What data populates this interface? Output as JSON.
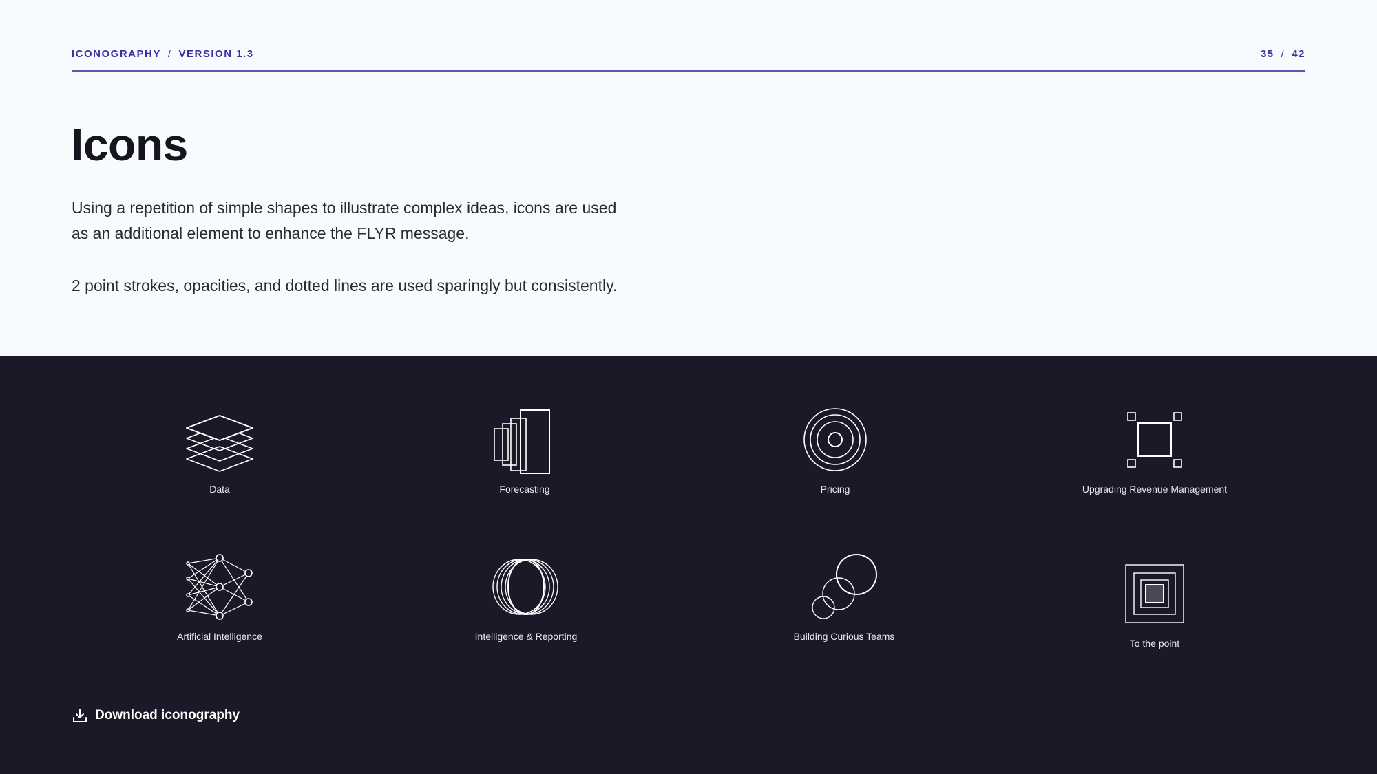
{
  "header": {
    "section": "ICONOGRAPHY",
    "separator": "/",
    "version": "VERSION 1.3",
    "page_current": "35",
    "page_total": "42"
  },
  "title": "Icons",
  "description_1": "Using a repetition of simple shapes to illustrate complex ideas, icons are used as an additional element to enhance the FLYR message.",
  "description_2": "2 point strokes, opacities, and dotted lines are used sparingly but consistently.",
  "icons": [
    {
      "label": "Data",
      "icon": "layers-icon"
    },
    {
      "label": "Forecasting",
      "icon": "stacked-rectangles-icon"
    },
    {
      "label": "Pricing",
      "icon": "target-icon"
    },
    {
      "label": "Upgrading Revenue Management",
      "icon": "selection-square-icon"
    },
    {
      "label": "Artificial Intelligence",
      "icon": "neural-network-icon"
    },
    {
      "label": "Intelligence & Reporting",
      "icon": "overlapping-ellipses-icon"
    },
    {
      "label": "Building Curious Teams",
      "icon": "ascending-circles-icon"
    },
    {
      "label": "To the point",
      "icon": "nested-squares-icon"
    }
  ],
  "download": {
    "label": "Download iconography",
    "icon": "download-icon"
  },
  "colors": {
    "accent": "#3d2fa3",
    "dark_background": "#1b1828",
    "light_background": "#f7fbfe"
  }
}
